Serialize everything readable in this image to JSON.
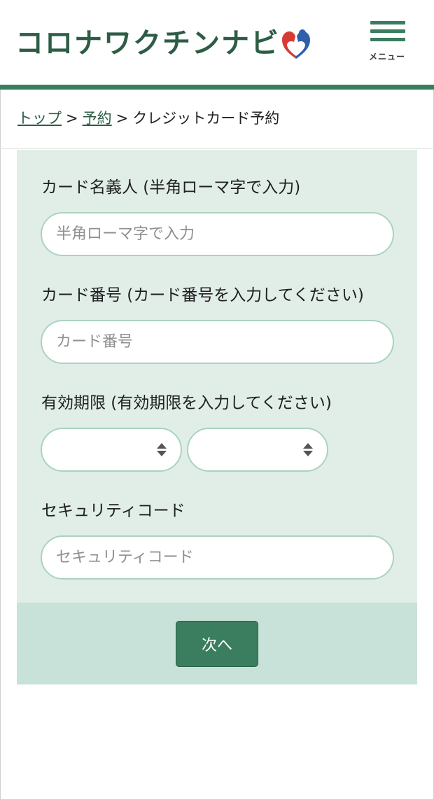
{
  "header": {
    "logo_text": "コロナワクチンナビ",
    "logo_icon": "heart-people-icon",
    "menu_icon": "hamburger-icon",
    "menu_label": "メニュー",
    "accent_color": "#3a7d5f",
    "logo_color": "#2d5d45"
  },
  "breadcrumb": {
    "items": [
      "トップ",
      "予約"
    ],
    "separator": ">",
    "current": "クレジットカード予約"
  },
  "form": {
    "cardholder": {
      "label": "カード名義人 (半角ローマ字で入力)",
      "placeholder": "半角ローマ字で入力",
      "value": ""
    },
    "card_number": {
      "label": "カード番号 (カード番号を入力してください)",
      "placeholder": "カード番号",
      "value": ""
    },
    "expiry": {
      "label": "有効期限 (有効期限を入力してください)",
      "month_value": "",
      "year_value": ""
    },
    "security_code": {
      "label": "セキュリティコード",
      "placeholder": "セキュリティコード",
      "value": ""
    },
    "panel_color": "#e1eee8",
    "field_border_color": "#a9d3c0"
  },
  "footer": {
    "next_label": "次へ",
    "panel_color": "#c9e2d9"
  }
}
